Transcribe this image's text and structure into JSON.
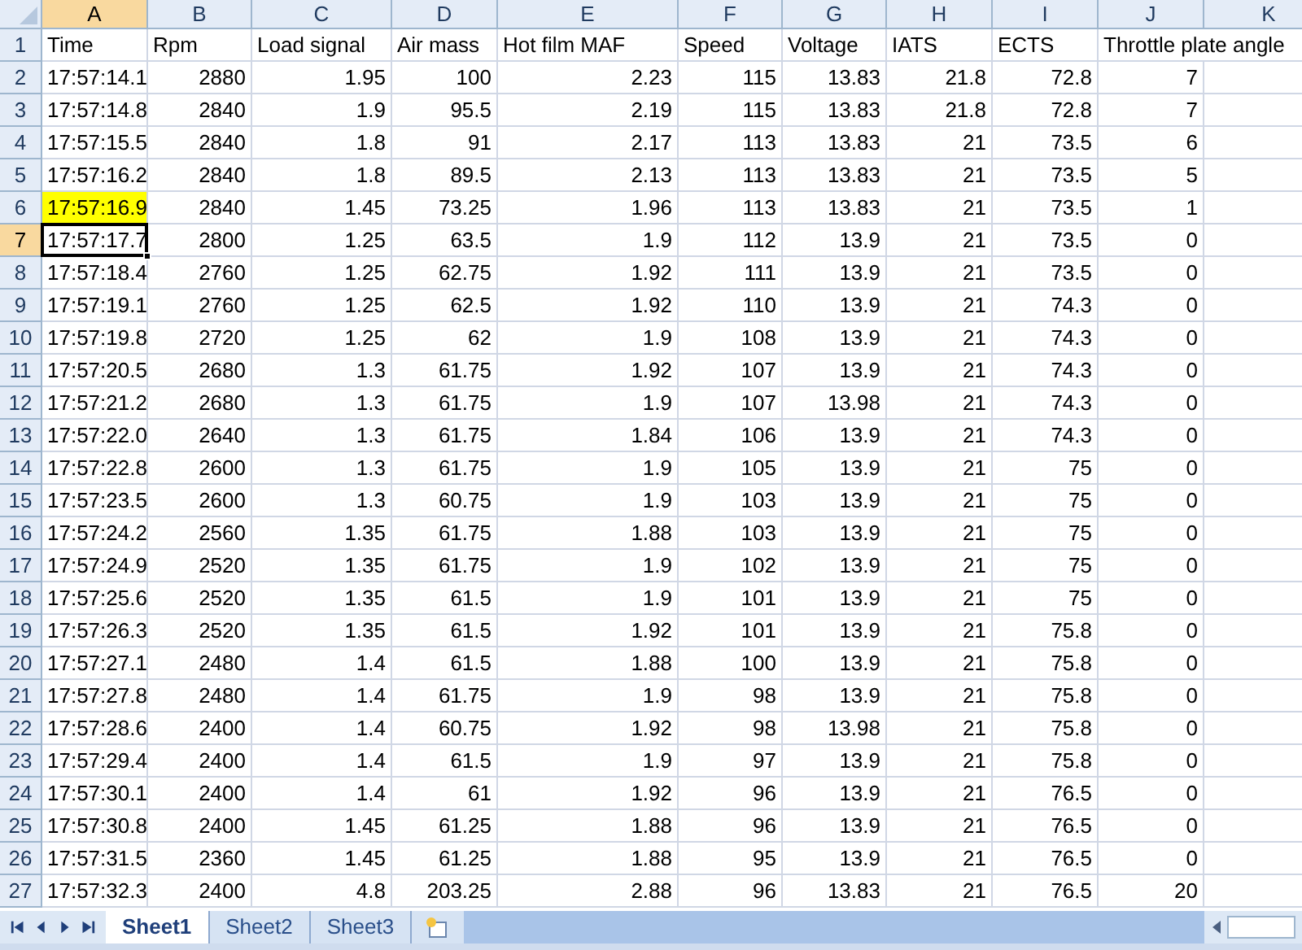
{
  "columns": [
    {
      "label": "A",
      "selected": true
    },
    {
      "label": "B",
      "selected": false
    },
    {
      "label": "C",
      "selected": false
    },
    {
      "label": "D",
      "selected": false
    },
    {
      "label": "E",
      "selected": false
    },
    {
      "label": "F",
      "selected": false
    },
    {
      "label": "G",
      "selected": false
    },
    {
      "label": "H",
      "selected": false
    },
    {
      "label": "I",
      "selected": false
    },
    {
      "label": "J",
      "selected": false
    },
    {
      "label": "K",
      "selected": false
    }
  ],
  "rows": [
    {
      "number": "1",
      "kind": "header",
      "selected": false,
      "marked": false,
      "cells": [
        "Time",
        "Rpm",
        "Load signal",
        "Air mass",
        "Hot film MAF",
        "Speed",
        "Voltage",
        "IATS",
        "ECTS",
        "Throttle plate angle"
      ]
    },
    {
      "number": "2",
      "kind": "data",
      "selected": false,
      "marked": false,
      "cells": [
        "17:57:14.1",
        "2880",
        "1.95",
        "100",
        "2.23",
        "115",
        "13.83",
        "21.8",
        "72.8",
        "7"
      ]
    },
    {
      "number": "3",
      "kind": "data",
      "selected": false,
      "marked": false,
      "cells": [
        "17:57:14.8",
        "2840",
        "1.9",
        "95.5",
        "2.19",
        "115",
        "13.83",
        "21.8",
        "72.8",
        "7"
      ]
    },
    {
      "number": "4",
      "kind": "data",
      "selected": false,
      "marked": false,
      "cells": [
        "17:57:15.5",
        "2840",
        "1.8",
        "91",
        "2.17",
        "113",
        "13.83",
        "21",
        "73.5",
        "6"
      ]
    },
    {
      "number": "5",
      "kind": "data",
      "selected": false,
      "marked": false,
      "cells": [
        "17:57:16.2",
        "2840",
        "1.8",
        "89.5",
        "2.13",
        "113",
        "13.83",
        "21",
        "73.5",
        "5"
      ]
    },
    {
      "number": "6",
      "kind": "data",
      "selected": false,
      "marked": true,
      "cells": [
        "17:57:16.9",
        "2840",
        "1.45",
        "73.25",
        "1.96",
        "113",
        "13.83",
        "21",
        "73.5",
        "1"
      ]
    },
    {
      "number": "7",
      "kind": "data",
      "selected": true,
      "marked": false,
      "cells": [
        "17:57:17.7",
        "2800",
        "1.25",
        "63.5",
        "1.9",
        "112",
        "13.9",
        "21",
        "73.5",
        "0"
      ]
    },
    {
      "number": "8",
      "kind": "data",
      "selected": false,
      "marked": false,
      "cells": [
        "17:57:18.4",
        "2760",
        "1.25",
        "62.75",
        "1.92",
        "111",
        "13.9",
        "21",
        "73.5",
        "0"
      ]
    },
    {
      "number": "9",
      "kind": "data",
      "selected": false,
      "marked": false,
      "cells": [
        "17:57:19.1",
        "2760",
        "1.25",
        "62.5",
        "1.92",
        "110",
        "13.9",
        "21",
        "74.3",
        "0"
      ]
    },
    {
      "number": "10",
      "kind": "data",
      "selected": false,
      "marked": false,
      "cells": [
        "17:57:19.8",
        "2720",
        "1.25",
        "62",
        "1.9",
        "108",
        "13.9",
        "21",
        "74.3",
        "0"
      ]
    },
    {
      "number": "11",
      "kind": "data",
      "selected": false,
      "marked": false,
      "cells": [
        "17:57:20.5",
        "2680",
        "1.3",
        "61.75",
        "1.92",
        "107",
        "13.9",
        "21",
        "74.3",
        "0"
      ]
    },
    {
      "number": "12",
      "kind": "data",
      "selected": false,
      "marked": false,
      "cells": [
        "17:57:21.2",
        "2680",
        "1.3",
        "61.75",
        "1.9",
        "107",
        "13.98",
        "21",
        "74.3",
        "0"
      ]
    },
    {
      "number": "13",
      "kind": "data",
      "selected": false,
      "marked": false,
      "cells": [
        "17:57:22.0",
        "2640",
        "1.3",
        "61.75",
        "1.84",
        "106",
        "13.9",
        "21",
        "74.3",
        "0"
      ]
    },
    {
      "number": "14",
      "kind": "data",
      "selected": false,
      "marked": false,
      "cells": [
        "17:57:22.8",
        "2600",
        "1.3",
        "61.75",
        "1.9",
        "105",
        "13.9",
        "21",
        "75",
        "0"
      ]
    },
    {
      "number": "15",
      "kind": "data",
      "selected": false,
      "marked": false,
      "cells": [
        "17:57:23.5",
        "2600",
        "1.3",
        "60.75",
        "1.9",
        "103",
        "13.9",
        "21",
        "75",
        "0"
      ]
    },
    {
      "number": "16",
      "kind": "data",
      "selected": false,
      "marked": false,
      "cells": [
        "17:57:24.2",
        "2560",
        "1.35",
        "61.75",
        "1.88",
        "103",
        "13.9",
        "21",
        "75",
        "0"
      ]
    },
    {
      "number": "17",
      "kind": "data",
      "selected": false,
      "marked": false,
      "cells": [
        "17:57:24.9",
        "2520",
        "1.35",
        "61.75",
        "1.9",
        "102",
        "13.9",
        "21",
        "75",
        "0"
      ]
    },
    {
      "number": "18",
      "kind": "data",
      "selected": false,
      "marked": false,
      "cells": [
        "17:57:25.6",
        "2520",
        "1.35",
        "61.5",
        "1.9",
        "101",
        "13.9",
        "21",
        "75",
        "0"
      ]
    },
    {
      "number": "19",
      "kind": "data",
      "selected": false,
      "marked": false,
      "cells": [
        "17:57:26.3",
        "2520",
        "1.35",
        "61.5",
        "1.92",
        "101",
        "13.9",
        "21",
        "75.8",
        "0"
      ]
    },
    {
      "number": "20",
      "kind": "data",
      "selected": false,
      "marked": false,
      "cells": [
        "17:57:27.1",
        "2480",
        "1.4",
        "61.5",
        "1.88",
        "100",
        "13.9",
        "21",
        "75.8",
        "0"
      ]
    },
    {
      "number": "21",
      "kind": "data",
      "selected": false,
      "marked": false,
      "cells": [
        "17:57:27.8",
        "2480",
        "1.4",
        "61.75",
        "1.9",
        "98",
        "13.9",
        "21",
        "75.8",
        "0"
      ]
    },
    {
      "number": "22",
      "kind": "data",
      "selected": false,
      "marked": false,
      "cells": [
        "17:57:28.6",
        "2400",
        "1.4",
        "60.75",
        "1.92",
        "98",
        "13.98",
        "21",
        "75.8",
        "0"
      ]
    },
    {
      "number": "23",
      "kind": "data",
      "selected": false,
      "marked": false,
      "cells": [
        "17:57:29.4",
        "2400",
        "1.4",
        "61.5",
        "1.9",
        "97",
        "13.9",
        "21",
        "75.8",
        "0"
      ]
    },
    {
      "number": "24",
      "kind": "data",
      "selected": false,
      "marked": false,
      "cells": [
        "17:57:30.1",
        "2400",
        "1.4",
        "61",
        "1.92",
        "96",
        "13.9",
        "21",
        "76.5",
        "0"
      ]
    },
    {
      "number": "25",
      "kind": "data",
      "selected": false,
      "marked": false,
      "cells": [
        "17:57:30.8",
        "2400",
        "1.45",
        "61.25",
        "1.88",
        "96",
        "13.9",
        "21",
        "76.5",
        "0"
      ]
    },
    {
      "number": "26",
      "kind": "data",
      "selected": false,
      "marked": false,
      "cells": [
        "17:57:31.5",
        "2360",
        "1.45",
        "61.25",
        "1.88",
        "95",
        "13.9",
        "21",
        "76.5",
        "0"
      ]
    },
    {
      "number": "27",
      "kind": "data",
      "selected": false,
      "marked": false,
      "cells": [
        "17:57:32.3",
        "2400",
        "4.8",
        "203.25",
        "2.88",
        "96",
        "13.83",
        "21",
        "76.5",
        "20"
      ]
    }
  ],
  "sheet_tabs": [
    {
      "label": "Sheet1",
      "selected": true
    },
    {
      "label": "Sheet2",
      "selected": false
    },
    {
      "label": "Sheet3",
      "selected": false
    }
  ]
}
